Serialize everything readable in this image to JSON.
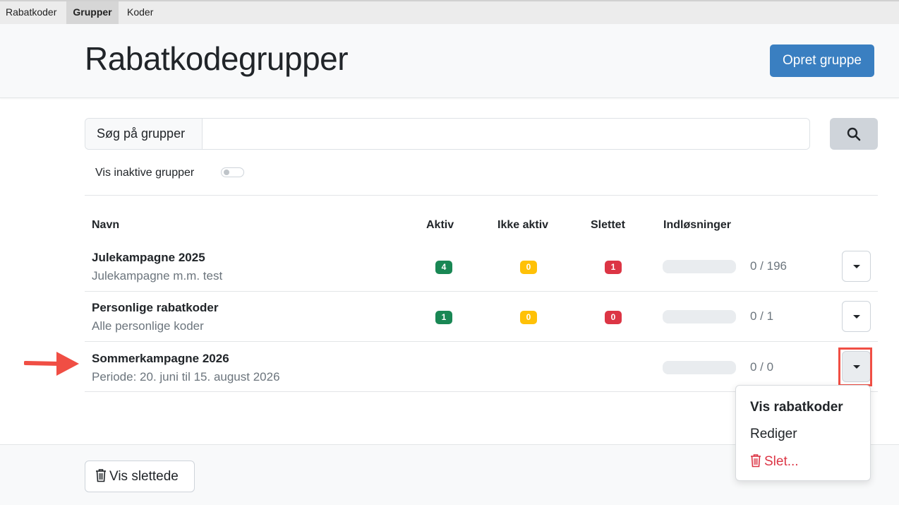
{
  "topnav": {
    "tabs": [
      {
        "label": "Rabatkoder",
        "active": false
      },
      {
        "label": "Grupper",
        "active": true
      },
      {
        "label": "Koder",
        "active": false
      }
    ]
  },
  "header": {
    "title": "Rabatkodegrupper",
    "create_label": "Opret gruppe"
  },
  "search": {
    "label": "Søg på grupper",
    "value": "",
    "button_icon": "search-icon"
  },
  "filters": {
    "inactive_label": "Vis inaktive grupper",
    "inactive_on": false
  },
  "table": {
    "headers": {
      "name": "Navn",
      "active": "Aktiv",
      "inactive": "Ikke aktiv",
      "deleted": "Slettet",
      "redemptions": "Indløsninger"
    },
    "rows": [
      {
        "name": "Julekampagne 2025",
        "desc": "Julekampagne m.m. test",
        "active": "4",
        "inactive": "0",
        "deleted": "1",
        "redemptions": "0 / 196",
        "progress": 0
      },
      {
        "name": "Personlige rabatkoder",
        "desc": "Alle personlige koder",
        "active": "1",
        "inactive": "0",
        "deleted": "0",
        "redemptions": "0 / 1",
        "progress": 0
      },
      {
        "name": "Sommerkampagne 2026",
        "desc": "Periode: 20. juni til 15. august 2026",
        "redemptions": "0 / 0",
        "progress": 0
      }
    ]
  },
  "dropdown_menu": {
    "view": "Vis rabatkoder",
    "edit": "Rediger",
    "delete": "Slet..."
  },
  "footer": {
    "deleted_label": "Vis slettede"
  },
  "colors": {
    "primary": "#3a7fc1",
    "success": "#198754",
    "warning": "#ffc107",
    "danger": "#dc3545",
    "annotation": "#f04e44"
  }
}
